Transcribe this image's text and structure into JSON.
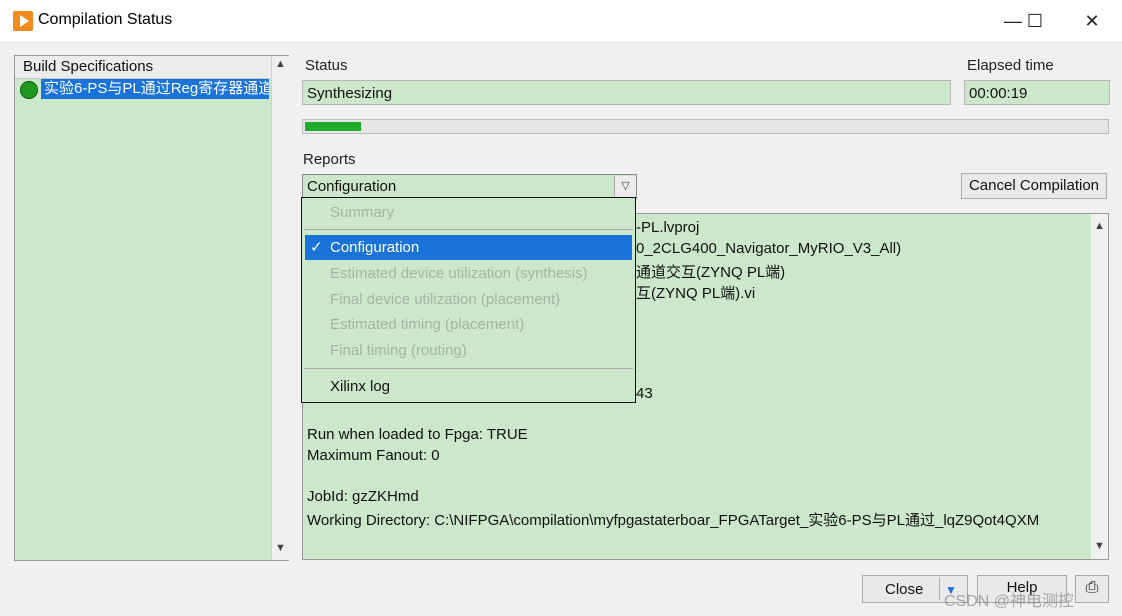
{
  "window": {
    "title": "Compilation Status",
    "controls": {
      "minimize": "—",
      "maximize": "☐",
      "close": "✕"
    }
  },
  "build_specifications": {
    "header": "Build Specifications",
    "items": [
      {
        "label": "实验6-PS与PL通过Reg寄存器通道",
        "status": "in-progress"
      }
    ]
  },
  "status": {
    "label": "Status",
    "value": "Synthesizing"
  },
  "elapsed": {
    "label": "Elapsed time",
    "value": "00:00:19"
  },
  "progress": {
    "fraction": 0.07
  },
  "reports": {
    "label": "Reports",
    "selected": "Configuration",
    "menu": [
      {
        "label": "Summary",
        "enabled": false
      },
      {
        "label": "Configuration",
        "enabled": true,
        "checked": true
      },
      {
        "label": "Estimated device utilization (synthesis)",
        "enabled": false
      },
      {
        "label": "Final device utilization (placement)",
        "enabled": false
      },
      {
        "label": "Estimated timing (placement)",
        "enabled": false
      },
      {
        "label": "Final timing (routing)",
        "enabled": false
      },
      {
        "label": "Xilinx log",
        "enabled": true
      }
    ]
  },
  "cancel_button": "Cancel Compilation",
  "report_lines": [
    "-PL.lvproj",
    "0_2CLG400_Navigator_MyRIO_V3_All)",
    "通道交互(ZYNQ PL端)",
    "互(ZYNQ PL端).vi",
    "43",
    "Run when loaded to Fpga: TRUE",
    "Maximum Fanout: 0",
    "JobId: gzZKHmd",
    "Working Directory: C:\\NIFPGA\\compilation\\myfpgastaterboar_FPGATarget_实验6-PS与PL通过_lqZ9Qot4QXM"
  ],
  "bottom": {
    "close": "Close",
    "help": "Help"
  },
  "watermark": "CSDN @神电测控",
  "icons": [
    "labview-app-icon",
    "status-dot-icon",
    "dropdown-arrow-icon",
    "checkmark-icon",
    "scroll-up-icon",
    "scroll-down-icon",
    "print-icon"
  ]
}
